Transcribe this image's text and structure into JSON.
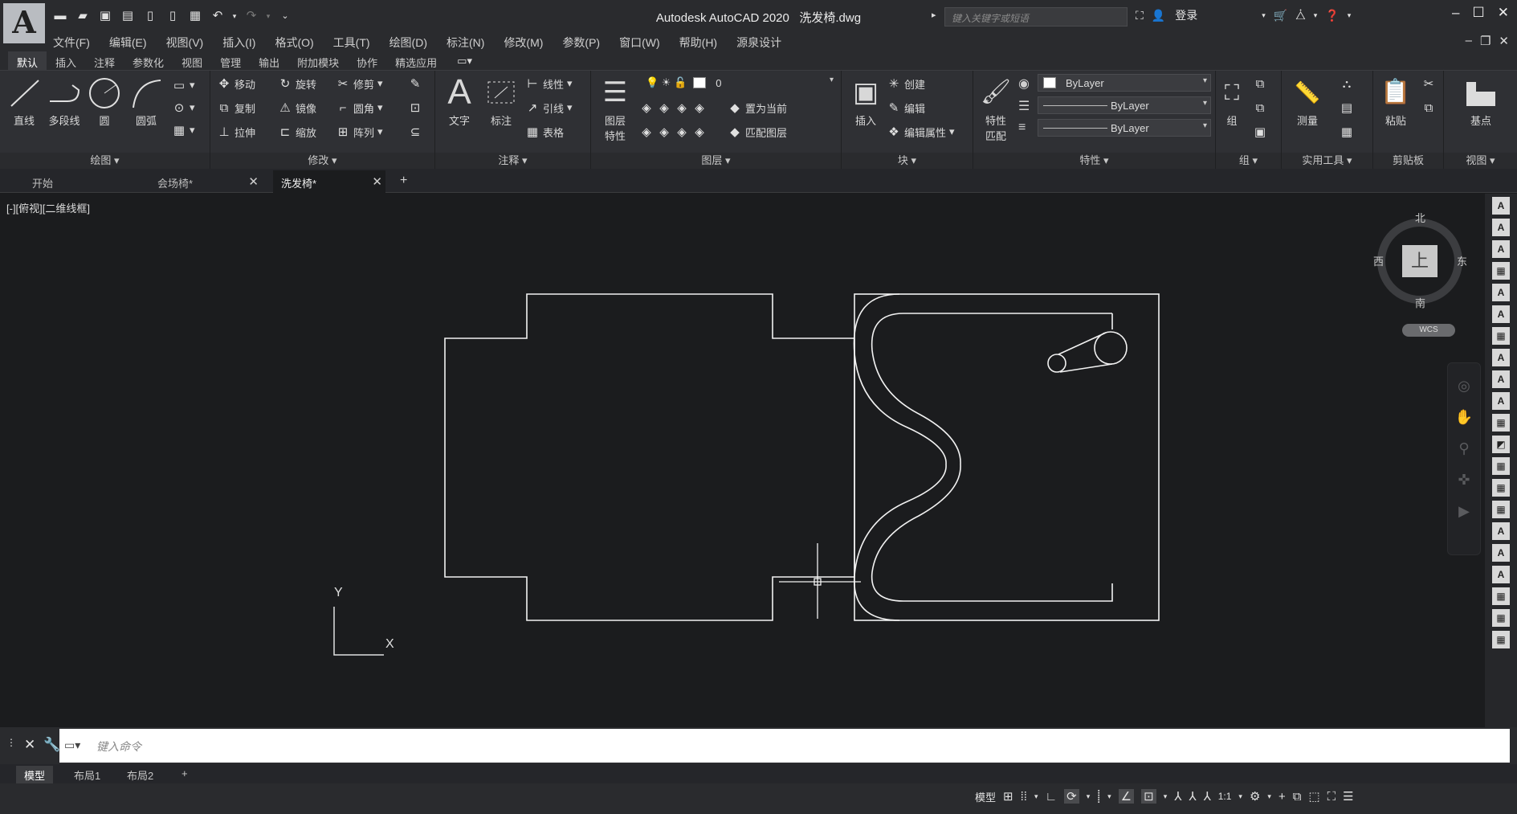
{
  "titlebar": {
    "app_name": "Autodesk AutoCAD 2020",
    "file_name": "洗发椅.dwg",
    "search_placeholder": "键入关键字或短语",
    "login_label": "登录",
    "logo_letter": "A"
  },
  "menu": [
    "文件(F)",
    "编辑(E)",
    "视图(V)",
    "插入(I)",
    "格式(O)",
    "工具(T)",
    "绘图(D)",
    "标注(N)",
    "修改(M)",
    "参数(P)",
    "窗口(W)",
    "帮助(H)",
    "源泉设计"
  ],
  "ribbon_tabs": [
    "默认",
    "插入",
    "注释",
    "参数化",
    "视图",
    "管理",
    "输出",
    "附加模块",
    "协作",
    "精选应用"
  ],
  "ribbon_tab_active": "默认",
  "panels": {
    "draw": {
      "title": "绘图",
      "buttons": [
        "直线",
        "多段线",
        "圆",
        "圆弧"
      ]
    },
    "modify": {
      "title": "修改",
      "items": [
        "移动",
        "旋转",
        "修剪",
        "复制",
        "镜像",
        "圆角",
        "拉伸",
        "缩放",
        "阵列"
      ]
    },
    "annotation": {
      "title": "注释",
      "big": [
        "文字",
        "标注"
      ],
      "items": [
        "线性",
        "引线",
        "表格"
      ]
    },
    "layers": {
      "title": "图层",
      "big": "图层特性",
      "layer_value": "0",
      "items": [
        "置为当前",
        "匹配图层"
      ]
    },
    "block": {
      "title": "块",
      "big": "插入",
      "items": [
        "创建",
        "编辑",
        "编辑属性"
      ]
    },
    "properties": {
      "title": "特性",
      "big": "特性匹配",
      "color": "ByLayer",
      "linetype": "ByLayer",
      "lineweight": "ByLayer"
    },
    "groups": {
      "title": "组",
      "big": "组"
    },
    "utilities": {
      "title": "实用工具",
      "big": "测量"
    },
    "clipboard": {
      "title": "剪贴板",
      "big": "粘贴"
    },
    "view": {
      "title": "视图",
      "big": "基点"
    }
  },
  "file_tabs": [
    {
      "label": "开始",
      "closable": false,
      "active": false
    },
    {
      "label": "会场椅*",
      "closable": true,
      "active": false
    },
    {
      "label": "洗发椅*",
      "closable": true,
      "active": true
    }
  ],
  "viewport": {
    "label": "[-][俯视][二维线框]",
    "ucs_y": "Y",
    "ucs_x": "X"
  },
  "viewcube": {
    "north": "北",
    "south": "南",
    "west": "西",
    "east": "东",
    "face": "上",
    "wcs": "WCS"
  },
  "command": {
    "placeholder": "键入命令"
  },
  "layout_tabs": [
    "模型",
    "布局1",
    "布局2"
  ],
  "status": {
    "model": "模型",
    "scale": "1:1"
  },
  "colors": {
    "background": "#1b1c1e",
    "drawing_lines": "#f2f2f2",
    "ribbon": "#2f3034"
  }
}
